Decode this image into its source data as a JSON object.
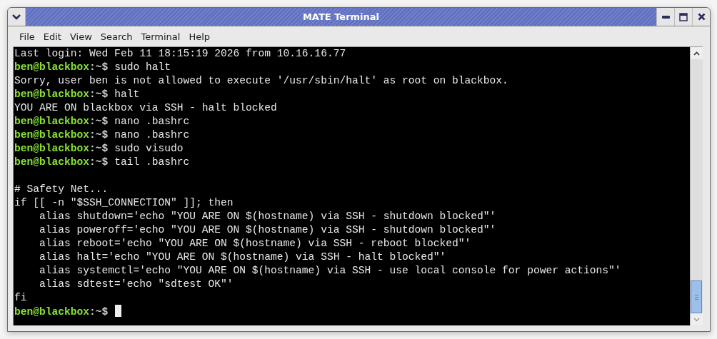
{
  "window": {
    "title": "MATE Terminal"
  },
  "menu": [
    "File",
    "Edit",
    "View",
    "Search",
    "Terminal",
    "Help"
  ],
  "terminal": {
    "lines": [
      {
        "kind": "output",
        "text": "Last login: Wed Feb 11 18:15:19 2026 from 10.16.16.77"
      },
      {
        "kind": "prompt",
        "host": "ben@blackbox",
        "path": ":~$",
        "command": "sudo halt"
      },
      {
        "kind": "output",
        "text": "Sorry, user ben is not allowed to execute '/usr/sbin/halt' as root on blackbox."
      },
      {
        "kind": "prompt",
        "host": "ben@blackbox",
        "path": ":~$",
        "command": "halt"
      },
      {
        "kind": "output",
        "text": "YOU ARE ON blackbox via SSH - halt blocked"
      },
      {
        "kind": "prompt",
        "host": "ben@blackbox",
        "path": ":~$",
        "command": "nano .bashrc"
      },
      {
        "kind": "prompt",
        "host": "ben@blackbox",
        "path": ":~$",
        "command": "nano .bashrc"
      },
      {
        "kind": "prompt",
        "host": "ben@blackbox",
        "path": ":~$",
        "command": "sudo visudo"
      },
      {
        "kind": "prompt",
        "host": "ben@blackbox",
        "path": ":~$",
        "command": "tail .bashrc"
      },
      {
        "kind": "blank"
      },
      {
        "kind": "output",
        "text": "# Safety Net..."
      },
      {
        "kind": "output",
        "text": "if [[ -n \"$SSH_CONNECTION\" ]]; then"
      },
      {
        "kind": "output",
        "text": "    alias shutdown='echo \"YOU ARE ON $(hostname) via SSH - shutdown blocked\"'"
      },
      {
        "kind": "output",
        "text": "    alias poweroff='echo \"YOU ARE ON $(hostname) via SSH - shutdown blocked\"'"
      },
      {
        "kind": "output",
        "text": "    alias reboot='echo \"YOU ARE ON $(hostname) via SSH - reboot blocked\"'"
      },
      {
        "kind": "output",
        "text": "    alias halt='echo \"YOU ARE ON $(hostname) via SSH - halt blocked\"'"
      },
      {
        "kind": "output",
        "text": "    alias systemctl='echo \"YOU ARE ON $(hostname) via SSH - use local console for power actions\"'"
      },
      {
        "kind": "output",
        "text": "    alias sdtest='echo \"sdtest OK\"'"
      },
      {
        "kind": "output",
        "text": "fi"
      },
      {
        "kind": "prompt",
        "host": "ben@blackbox",
        "path": ":~$",
        "cursor": true
      }
    ]
  }
}
